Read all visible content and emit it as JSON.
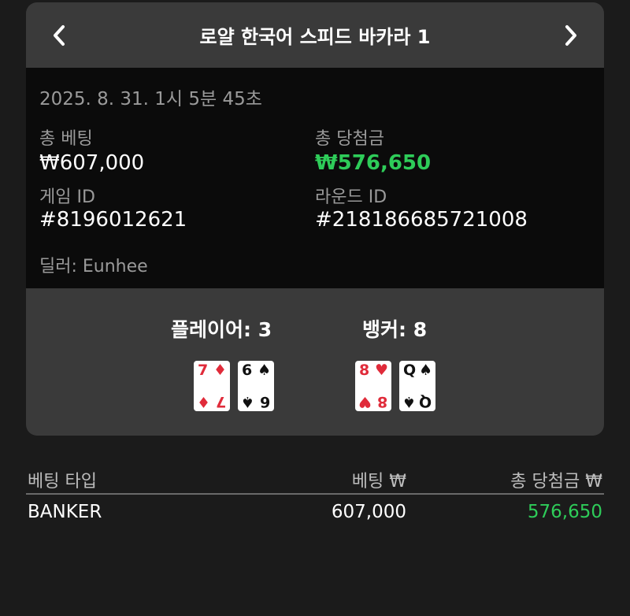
{
  "header": {
    "title": "로얄 한국어 스피드 바카라 1"
  },
  "info": {
    "timestamp": "2025. 8. 31. 1시 5분 45초",
    "total_bet_label": "총 베팅",
    "total_bet_value": "₩607,000",
    "total_win_label": "총 당첨금",
    "total_win_value": "₩576,650",
    "game_id_label": "게임 ID",
    "game_id_value": "#8196012621",
    "round_id_label": "라운드 ID",
    "round_id_value": "#218186685721008",
    "dealer": "딜러: Eunhee"
  },
  "hands": {
    "player_label": "플레이어: 3",
    "banker_label": "뱅커: 8",
    "player_cards": [
      {
        "rank": "7",
        "suit": "♦",
        "color": "#e02b3a"
      },
      {
        "rank": "6",
        "suit": "♠",
        "color": "#111111"
      }
    ],
    "banker_cards": [
      {
        "rank": "8",
        "suit": "♥",
        "color": "#e02b3a"
      },
      {
        "rank": "Q",
        "suit": "♠",
        "color": "#111111"
      }
    ]
  },
  "bets_table": {
    "headers": [
      "베팅 타입",
      "베팅 ₩",
      "총 당첨금 ₩"
    ],
    "rows": [
      {
        "type": "BANKER",
        "bet": "607,000",
        "win": "576,650"
      }
    ]
  },
  "colors": {
    "accent_green": "#2ecc59",
    "panel_bg": "#3a3a3a",
    "info_bg": "#0b0b0b"
  }
}
